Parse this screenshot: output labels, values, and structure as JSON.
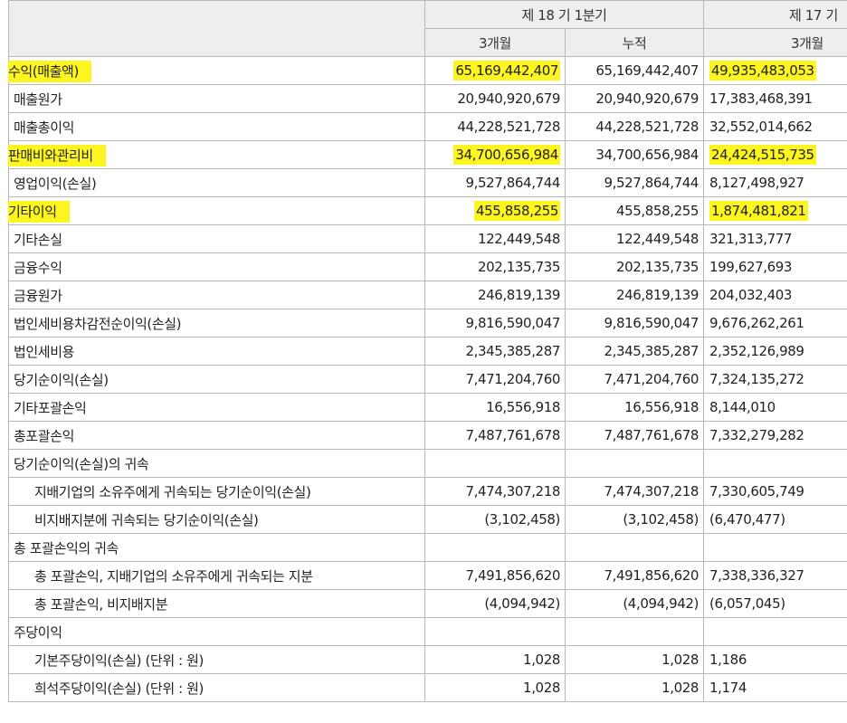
{
  "header": {
    "period_current": "제 18 기 1분기",
    "period_prior": "제 17 기",
    "sub_3m": "3개월",
    "sub_cum": "누적",
    "sub_prior_3m": "3개월"
  },
  "rows": [
    {
      "label": "수익(매출액)",
      "cur3m": "65,169,442,407",
      "cum": "65,169,442,407",
      "prior": "49,935,483,053",
      "hl_label": true,
      "hl_cur": true,
      "hl_prior": true
    },
    {
      "label": "매출원가",
      "cur3m": "20,940,920,679",
      "cum": "20,940,920,679",
      "prior": "17,383,468,391"
    },
    {
      "label": "매출총이익",
      "cur3m": "44,228,521,728",
      "cum": "44,228,521,728",
      "prior": "32,552,014,662"
    },
    {
      "label": "판매비와관리비",
      "cur3m": "34,700,656,984",
      "cum": "34,700,656,984",
      "prior": "24,424,515,735",
      "hl_label": true,
      "hl_cur": true,
      "hl_prior": true
    },
    {
      "label": "영업이익(손실)",
      "cur3m": "9,527,864,744",
      "cum": "9,527,864,744",
      "prior": "8,127,498,927"
    },
    {
      "label": "기타이익",
      "cur3m": "455,858,255",
      "cum": "455,858,255",
      "prior": "1,874,481,821",
      "hl_label": true,
      "hl_cur": true,
      "hl_prior": true
    },
    {
      "label": "기타손실",
      "cur3m": "122,449,548",
      "cum": "122,449,548",
      "prior": "321,313,777"
    },
    {
      "label": "금융수익",
      "cur3m": "202,135,735",
      "cum": "202,135,735",
      "prior": "199,627,693"
    },
    {
      "label": "금융원가",
      "cur3m": "246,819,139",
      "cum": "246,819,139",
      "prior": "204,032,403"
    },
    {
      "label": "법인세비용차감전순이익(손실)",
      "cur3m": "9,816,590,047",
      "cum": "9,816,590,047",
      "prior": "9,676,262,261"
    },
    {
      "label": "법인세비용",
      "cur3m": "2,345,385,287",
      "cum": "2,345,385,287",
      "prior": "2,352,126,989"
    },
    {
      "label": "당기순이익(손실)",
      "cur3m": "7,471,204,760",
      "cum": "7,471,204,760",
      "prior": "7,324,135,272"
    },
    {
      "label": "기타포괄손익",
      "cur3m": "16,556,918",
      "cum": "16,556,918",
      "prior": "8,144,010"
    },
    {
      "label": "총포괄손익",
      "cur3m": "7,487,761,678",
      "cum": "7,487,761,678",
      "prior": "7,332,279,282"
    },
    {
      "label": "당기순이익(손실)의 귀속",
      "cur3m": "",
      "cum": "",
      "prior": ""
    },
    {
      "label": "지배기업의 소유주에게 귀속되는 당기순이익(손실)",
      "cur3m": "7,474,307,218",
      "cum": "7,474,307,218",
      "prior": "7,330,605,749",
      "indent": true
    },
    {
      "label": "비지배지분에 귀속되는 당기순이익(손실)",
      "cur3m": "(3,102,458)",
      "cum": "(3,102,458)",
      "prior": "(6,470,477)",
      "indent": true
    },
    {
      "label": "총 포괄손익의 귀속",
      "cur3m": "",
      "cum": "",
      "prior": ""
    },
    {
      "label": "총 포괄손익, 지배기업의 소유주에게 귀속되는 지분",
      "cur3m": "7,491,856,620",
      "cum": "7,491,856,620",
      "prior": "7,338,336,327",
      "indent": true
    },
    {
      "label": "총 포괄손익, 비지배지분",
      "cur3m": "(4,094,942)",
      "cum": "(4,094,942)",
      "prior": "(6,057,045)",
      "indent": true
    },
    {
      "label": "주당이익",
      "cur3m": "",
      "cum": "",
      "prior": ""
    },
    {
      "label": "기본주당이익(손실) (단위 : 원)",
      "cur3m": "1,028",
      "cum": "1,028",
      "prior": "1,186",
      "indent": true
    },
    {
      "label": "희석주당이익(손실) (단위 : 원)",
      "cur3m": "1,028",
      "cum": "1,028",
      "prior": "1,174",
      "indent": true
    }
  ],
  "highlight_color": "#fdf520"
}
